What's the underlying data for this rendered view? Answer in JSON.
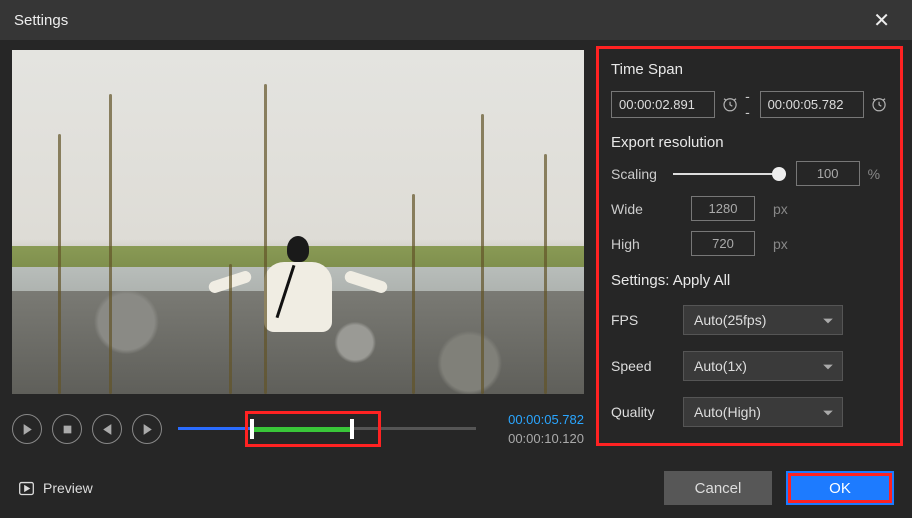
{
  "title": "Settings",
  "times": {
    "current": "00:00:05.782",
    "total": "00:00:10.120"
  },
  "timespan": {
    "label": "Time Span",
    "start": "00:00:02.891",
    "end": "00:00:05.782",
    "separator": "--"
  },
  "resolution": {
    "label": "Export resolution",
    "scaling_label": "Scaling",
    "scaling_value": "100",
    "scaling_unit": "%",
    "wide_label": "Wide",
    "wide_value": "1280",
    "wide_unit": "px",
    "high_label": "High",
    "high_value": "720",
    "high_unit": "px"
  },
  "apply_all_label": "Settings: Apply All",
  "fps": {
    "label": "FPS",
    "value": "Auto(25fps)"
  },
  "speed": {
    "label": "Speed",
    "value": "Auto(1x)"
  },
  "quality": {
    "label": "Quality",
    "value": "Auto(High)"
  },
  "footer": {
    "preview": "Preview",
    "cancel": "Cancel",
    "ok": "OK"
  }
}
